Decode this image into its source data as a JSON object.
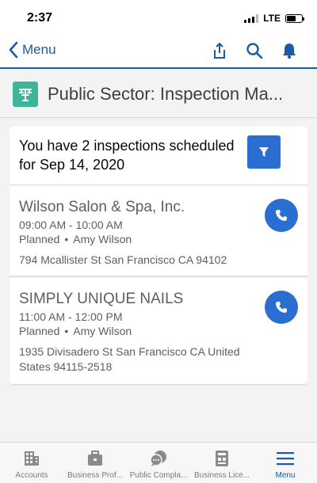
{
  "status_bar": {
    "time": "2:37",
    "network": "LTE"
  },
  "nav": {
    "back_label": "Menu",
    "icons": [
      "share-icon",
      "search-icon",
      "bell-icon"
    ],
    "accent_color": "#1b5aa5"
  },
  "header": {
    "title": "Public Sector: Inspection Ma...",
    "logo_color": "#3eb49b"
  },
  "summary": {
    "text": "You have 2 inspections scheduled for Sep 14, 2020"
  },
  "inspections": [
    {
      "name": "Wilson Salon & Spa, Inc.",
      "time": "09:00 AM - 10:00 AM",
      "status": "Planned",
      "separator": "•",
      "owner": "Amy Wilson",
      "address": "794 Mcallister St San Francisco CA 94102"
    },
    {
      "name": "SIMPLY UNIQUE NAILS",
      "time": "11:00 AM - 12:00 PM",
      "status": "Planned",
      "separator": "•",
      "owner": "Amy Wilson",
      "address": "1935 Divisadero St San Francisco CA United States 94115-2518"
    }
  ],
  "tabs": [
    {
      "label": "Accounts",
      "icon": "building-icon"
    },
    {
      "label": "Business Prof...",
      "icon": "briefcase-icon"
    },
    {
      "label": "Public Compla...",
      "icon": "chat-icon"
    },
    {
      "label": "Business Lice...",
      "icon": "license-icon"
    },
    {
      "label": "Menu",
      "icon": "hamburger-icon",
      "active": true
    }
  ]
}
